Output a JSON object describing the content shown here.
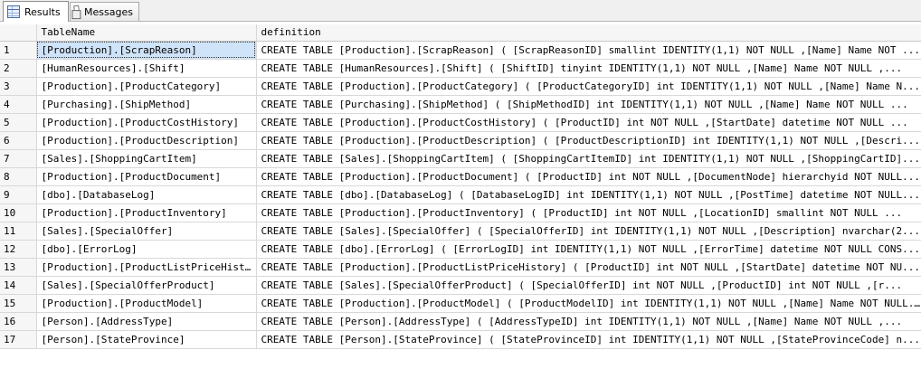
{
  "tabs": [
    {
      "label": "Results",
      "icon": "grid-icon",
      "active": true
    },
    {
      "label": "Messages",
      "icon": "messages-icon",
      "active": false
    }
  ],
  "columns": [
    "",
    "TableName",
    "definition"
  ],
  "rows": [
    {
      "n": "1",
      "name": "[Production].[ScrapReason]",
      "def": "CREATE TABLE [Production].[ScrapReason]   (      [ScrapReasonID] smallint IDENTITY(1,1) NOT NULL   ,[Name] Name NOT ..."
    },
    {
      "n": "2",
      "name": "[HumanResources].[Shift]",
      "def": "CREATE TABLE [HumanResources].[Shift]   (      [ShiftID] tinyint IDENTITY(1,1) NOT NULL   ,[Name] Name NOT NULL   ,..."
    },
    {
      "n": "3",
      "name": "[Production].[ProductCategory]",
      "def": "CREATE TABLE [Production].[ProductCategory]   (      [ProductCategoryID] int IDENTITY(1,1) NOT NULL   ,[Name] Name N..."
    },
    {
      "n": "4",
      "name": "[Purchasing].[ShipMethod]",
      "def": "CREATE TABLE [Purchasing].[ShipMethod]   (      [ShipMethodID] int IDENTITY(1,1) NOT NULL   ,[Name] Name NOT NULL  ..."
    },
    {
      "n": "5",
      "name": "[Production].[ProductCostHistory]",
      "def": "CREATE TABLE [Production].[ProductCostHistory]   (      [ProductID] int NOT NULL   ,[StartDate] datetime NOT NULL   ..."
    },
    {
      "n": "6",
      "name": "[Production].[ProductDescription]",
      "def": "CREATE TABLE [Production].[ProductDescription]   (      [ProductDescriptionID] int IDENTITY(1,1) NOT NULL   ,[Descri..."
    },
    {
      "n": "7",
      "name": "[Sales].[ShoppingCartItem]",
      "def": "CREATE TABLE [Sales].[ShoppingCartItem]   (      [ShoppingCartItemID] int IDENTITY(1,1) NOT NULL   ,[ShoppingCartID]..."
    },
    {
      "n": "8",
      "name": "[Production].[ProductDocument]",
      "def": "CREATE TABLE [Production].[ProductDocument]   (      [ProductID] int NOT NULL   ,[DocumentNode] hierarchyid NOT NULL..."
    },
    {
      "n": "9",
      "name": "[dbo].[DatabaseLog]",
      "def": "CREATE TABLE [dbo].[DatabaseLog]   (      [DatabaseLogID] int IDENTITY(1,1) NOT NULL   ,[PostTime] datetime NOT NULL..."
    },
    {
      "n": "10",
      "name": "[Production].[ProductInventory]",
      "def": "CREATE TABLE [Production].[ProductInventory]   (      [ProductID] int NOT NULL   ,[LocationID] smallint NOT NULL   ..."
    },
    {
      "n": "11",
      "name": "[Sales].[SpecialOffer]",
      "def": "CREATE TABLE [Sales].[SpecialOffer]   (      [SpecialOfferID] int IDENTITY(1,1) NOT NULL   ,[Description] nvarchar(2..."
    },
    {
      "n": "12",
      "name": "[dbo].[ErrorLog]",
      "def": "CREATE TABLE [dbo].[ErrorLog]   (      [ErrorLogID] int IDENTITY(1,1) NOT NULL   ,[ErrorTime] datetime NOT NULL CONS..."
    },
    {
      "n": "13",
      "name": "[Production].[ProductListPriceHistory]",
      "def": "CREATE TABLE [Production].[ProductListPriceHistory]   (      [ProductID] int NOT NULL   ,[StartDate] datetime NOT NU..."
    },
    {
      "n": "14",
      "name": "[Sales].[SpecialOfferProduct]",
      "def": "CREATE TABLE [Sales].[SpecialOfferProduct]   (      [SpecialOfferID] int NOT NULL   ,[ProductID] int NOT NULL   ,[r..."
    },
    {
      "n": "15",
      "name": "[Production].[ProductModel]",
      "def": "CREATE TABLE [Production].[ProductModel]   (      [ProductModelID] int IDENTITY(1,1) NOT NULL   ,[Name] Name NOT NULL..."
    },
    {
      "n": "16",
      "name": "[Person].[AddressType]",
      "def": "CREATE TABLE [Person].[AddressType]   (      [AddressTypeID] int IDENTITY(1,1) NOT NULL   ,[Name] Name NOT NULL   ,..."
    },
    {
      "n": "17",
      "name": "[Person].[StateProvince]",
      "def": "CREATE TABLE [Person].[StateProvince]   (      [StateProvinceID] int IDENTITY(1,1) NOT NULL   ,[StateProvinceCode] n..."
    }
  ]
}
